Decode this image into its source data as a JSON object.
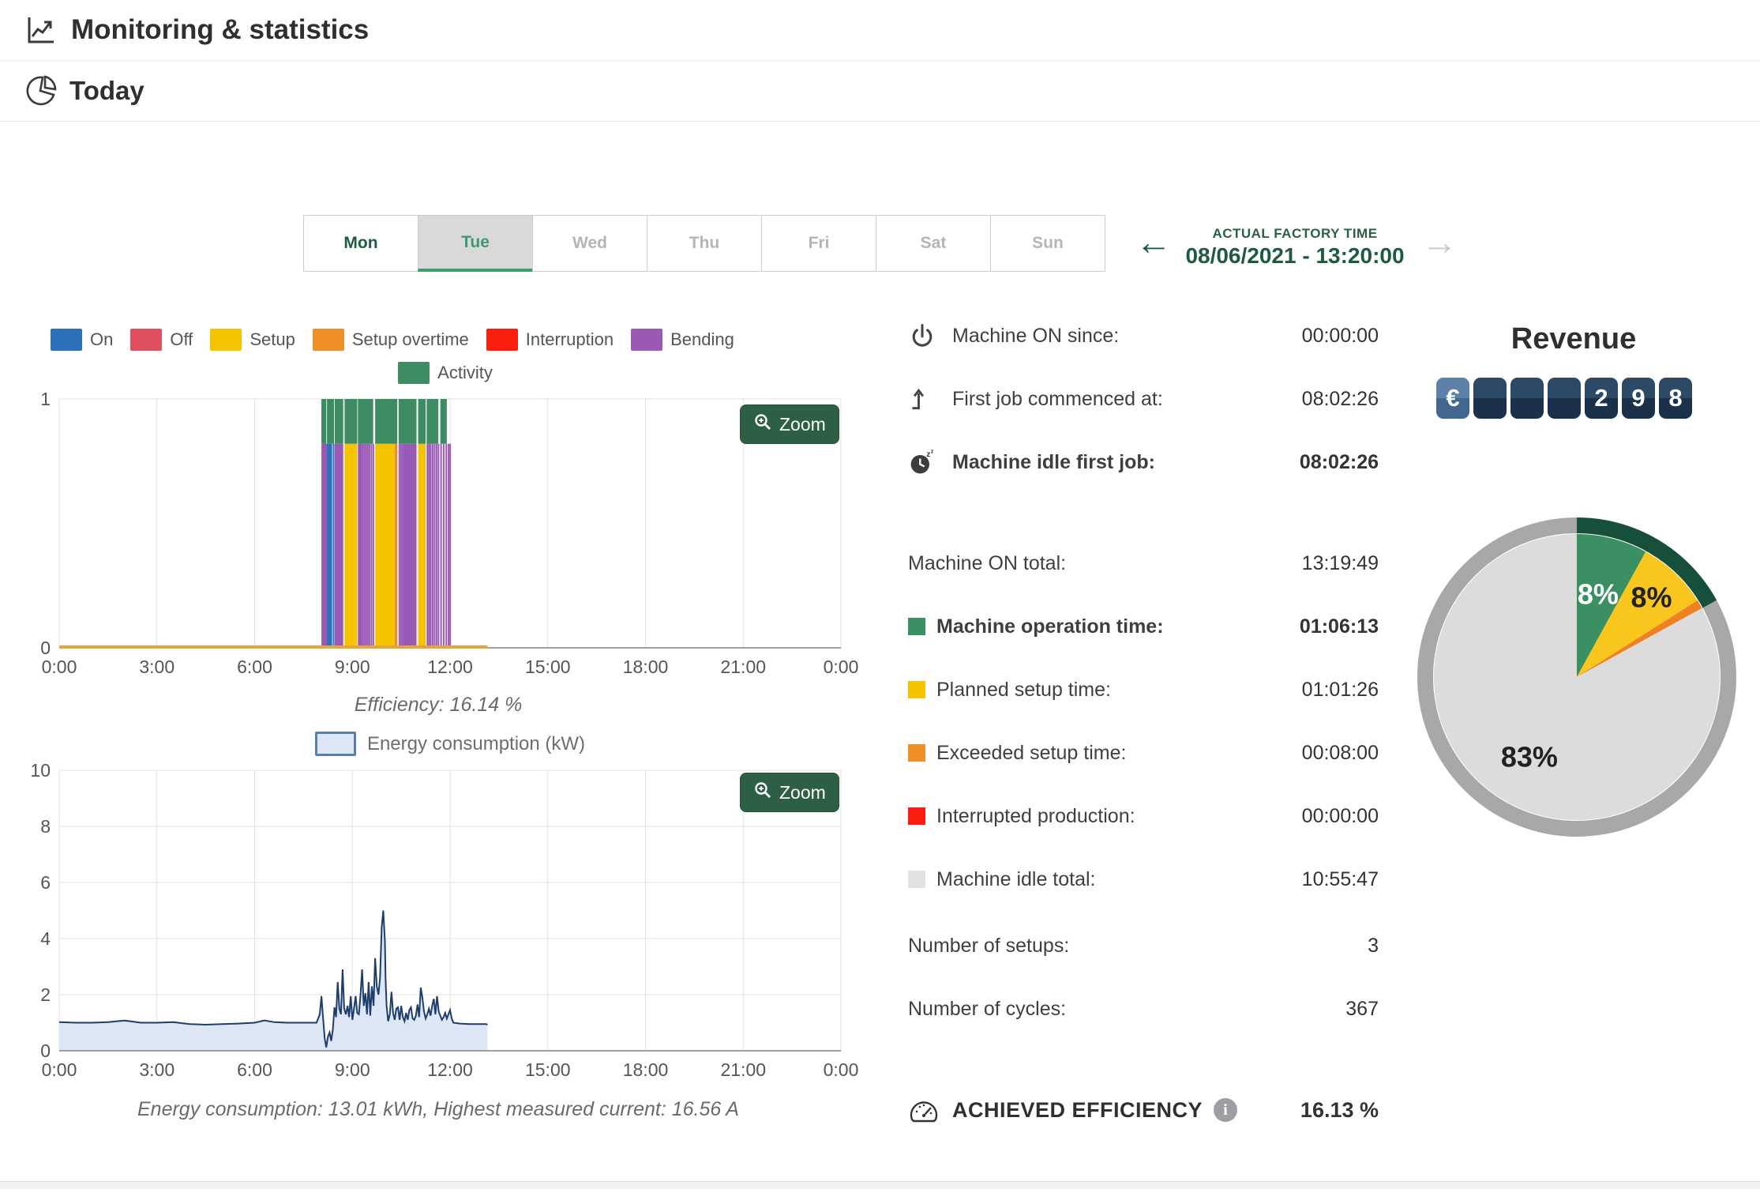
{
  "header": {
    "title": "Monitoring & statistics"
  },
  "section": {
    "title": "Today"
  },
  "tabs": [
    {
      "label": "Mon",
      "state": "enabled"
    },
    {
      "label": "Tue",
      "state": "active"
    },
    {
      "label": "Wed",
      "state": "disabled"
    },
    {
      "label": "Thu",
      "state": "disabled"
    },
    {
      "label": "Fri",
      "state": "disabled"
    },
    {
      "label": "Sat",
      "state": "disabled"
    },
    {
      "label": "Sun",
      "state": "disabled"
    }
  ],
  "factory_time": {
    "label": "ACTUAL FACTORY TIME",
    "value": "08/06/2021 - 13:20:00",
    "prev_arrow": "←",
    "next_arrow": "→"
  },
  "zoom_button_label": "Zoom",
  "legend_states": [
    {
      "label": "On",
      "color": "#2d72b8"
    },
    {
      "label": "Off",
      "color": "#e04f5f"
    },
    {
      "label": "Setup",
      "color": "#f5c300"
    },
    {
      "label": "Setup overtime",
      "color": "#ee8e25"
    },
    {
      "label": "Interruption",
      "color": "#fa1e0e"
    },
    {
      "label": "Bending",
      "color": "#9b59b6"
    }
  ],
  "legend_activity": {
    "label": "Activity",
    "color": "#3e8d62"
  },
  "energy_legend": {
    "label": "Energy consumption (kW)",
    "fill": "#dce6f5",
    "border": "#5b7fa6"
  },
  "captions": {
    "efficiency": "Efficiency: 16.14 %",
    "energy": "Energy consumption: 13.01 kWh, Highest measured current: 16.56 A"
  },
  "chart_data": [
    {
      "type": "timeline",
      "x_ticks": [
        "0:00",
        "3:00",
        "6:00",
        "9:00",
        "12:00",
        "15:00",
        "18:00",
        "21:00",
        "0:00"
      ],
      "x_range_hours": [
        0,
        24
      ],
      "y_ticks": [
        "0",
        "1"
      ],
      "band_split": 0.82,
      "baseline": {
        "start": 0,
        "end": 13.15,
        "color": "#e8a33d"
      },
      "colors": {
        "on": "#2d72b8",
        "off": "#e04f5f",
        "setup": "#f5c300",
        "setup_overtime": "#ee8e25",
        "interruption": "#fa1e0e",
        "bending": "#9b59b6",
        "activity": "#3e8d62"
      },
      "state_segments": [
        {
          "s": 8.05,
          "e": 8.08,
          "c": "bending"
        },
        {
          "s": 8.09,
          "e": 8.11,
          "c": "bending"
        },
        {
          "s": 8.12,
          "e": 8.14,
          "c": "bending"
        },
        {
          "s": 8.15,
          "e": 8.17,
          "c": "bending"
        },
        {
          "s": 8.18,
          "e": 8.21,
          "c": "bending"
        },
        {
          "s": 8.22,
          "e": 8.38,
          "c": "on"
        },
        {
          "s": 8.4,
          "e": 8.43,
          "c": "on"
        },
        {
          "s": 8.46,
          "e": 8.49,
          "c": "bending"
        },
        {
          "s": 8.5,
          "e": 8.52,
          "c": "bending"
        },
        {
          "s": 8.54,
          "e": 8.57,
          "c": "bending"
        },
        {
          "s": 8.58,
          "e": 8.6,
          "c": "bending"
        },
        {
          "s": 8.62,
          "e": 8.65,
          "c": "bending"
        },
        {
          "s": 8.66,
          "e": 8.72,
          "c": "bending"
        },
        {
          "s": 8.76,
          "e": 9.15,
          "c": "setup"
        },
        {
          "s": 9.17,
          "e": 9.19,
          "c": "bending"
        },
        {
          "s": 9.21,
          "e": 9.23,
          "c": "bending"
        },
        {
          "s": 9.25,
          "e": 9.28,
          "c": "bending"
        },
        {
          "s": 9.3,
          "e": 9.32,
          "c": "bending"
        },
        {
          "s": 9.35,
          "e": 9.37,
          "c": "bending"
        },
        {
          "s": 9.4,
          "e": 9.42,
          "c": "bending"
        },
        {
          "s": 9.45,
          "e": 9.47,
          "c": "bending"
        },
        {
          "s": 9.5,
          "e": 9.53,
          "c": "bending"
        },
        {
          "s": 9.56,
          "e": 9.58,
          "c": "bending"
        },
        {
          "s": 9.62,
          "e": 9.64,
          "c": "bending"
        },
        {
          "s": 9.7,
          "e": 10.3,
          "c": "setup"
        },
        {
          "s": 10.3,
          "e": 10.38,
          "c": "setup_overtime"
        },
        {
          "s": 10.42,
          "e": 10.44,
          "c": "bending"
        },
        {
          "s": 10.47,
          "e": 10.49,
          "c": "bending"
        },
        {
          "s": 10.52,
          "e": 10.54,
          "c": "bending"
        },
        {
          "s": 10.57,
          "e": 10.97,
          "c": "bending"
        },
        {
          "s": 11.02,
          "e": 11.25,
          "c": "setup"
        },
        {
          "s": 11.28,
          "e": 11.3,
          "c": "bending"
        },
        {
          "s": 11.33,
          "e": 11.35,
          "c": "bending"
        },
        {
          "s": 11.38,
          "e": 11.4,
          "c": "bending"
        },
        {
          "s": 11.44,
          "e": 11.46,
          "c": "bending"
        },
        {
          "s": 11.5,
          "e": 11.52,
          "c": "bending"
        },
        {
          "s": 11.56,
          "e": 11.58,
          "c": "bending"
        },
        {
          "s": 11.62,
          "e": 11.64,
          "c": "bending"
        },
        {
          "s": 11.7,
          "e": 11.72,
          "c": "bending"
        },
        {
          "s": 11.78,
          "e": 11.8,
          "c": "bending"
        },
        {
          "s": 11.86,
          "e": 11.88,
          "c": "bending"
        },
        {
          "s": 11.93,
          "e": 11.94,
          "c": "bending"
        },
        {
          "s": 11.98,
          "e": 11.99,
          "c": "bending"
        }
      ],
      "activity_segments": [
        {
          "s": 8.05,
          "e": 8.2
        },
        {
          "s": 8.22,
          "e": 8.44
        },
        {
          "s": 8.46,
          "e": 8.72
        },
        {
          "s": 8.76,
          "e": 9.15
        },
        {
          "s": 9.17,
          "e": 9.64
        },
        {
          "s": 9.7,
          "e": 10.38
        },
        {
          "s": 10.42,
          "e": 10.97
        },
        {
          "s": 11.02,
          "e": 11.25
        },
        {
          "s": 11.28,
          "e": 11.64
        },
        {
          "s": 11.7,
          "e": 11.9
        }
      ]
    },
    {
      "type": "area",
      "series_label": "Energy consumption (kW)",
      "x_ticks": [
        "0:00",
        "3:00",
        "6:00",
        "9:00",
        "12:00",
        "15:00",
        "18:00",
        "21:00",
        "0:00"
      ],
      "x_range_hours": [
        0,
        24
      ],
      "y_ticks": [
        0,
        2,
        4,
        6,
        8,
        10
      ],
      "ylim": [
        0,
        10
      ],
      "line_color": "#1e3d6b",
      "fill_color": "#dce6f5",
      "points": [
        [
          0,
          1.02
        ],
        [
          0.5,
          1.0
        ],
        [
          1,
          1.0
        ],
        [
          1.5,
          1.02
        ],
        [
          2,
          1.08
        ],
        [
          2.2,
          1.05
        ],
        [
          2.5,
          1.0
        ],
        [
          3,
          1.0
        ],
        [
          3.5,
          1.02
        ],
        [
          4,
          0.95
        ],
        [
          4.5,
          0.93
        ],
        [
          5,
          0.95
        ],
        [
          5.5,
          0.97
        ],
        [
          6,
          1.0
        ],
        [
          6.3,
          1.08
        ],
        [
          6.6,
          1.02
        ],
        [
          7,
          1.0
        ],
        [
          7.5,
          1.0
        ],
        [
          7.9,
          1.0
        ],
        [
          8.0,
          1.3
        ],
        [
          8.05,
          1.95
        ],
        [
          8.1,
          1.2
        ],
        [
          8.15,
          0.45
        ],
        [
          8.2,
          0.12
        ],
        [
          8.25,
          0.5
        ],
        [
          8.3,
          0.65
        ],
        [
          8.35,
          0.35
        ],
        [
          8.4,
          0.75
        ],
        [
          8.45,
          1.55
        ],
        [
          8.5,
          1.2
        ],
        [
          8.55,
          2.45
        ],
        [
          8.6,
          1.5
        ],
        [
          8.65,
          1.3
        ],
        [
          8.7,
          2.9
        ],
        [
          8.75,
          1.5
        ],
        [
          8.8,
          1.3
        ],
        [
          8.85,
          1.6
        ],
        [
          8.9,
          1.2
        ],
        [
          8.95,
          1.95
        ],
        [
          9.0,
          1.1
        ],
        [
          9.05,
          1.5
        ],
        [
          9.1,
          1.95
        ],
        [
          9.15,
          1.35
        ],
        [
          9.2,
          1.3
        ],
        [
          9.25,
          2.0
        ],
        [
          9.3,
          2.9
        ],
        [
          9.35,
          1.6
        ],
        [
          9.4,
          2.05
        ],
        [
          9.45,
          1.3
        ],
        [
          9.5,
          2.45
        ],
        [
          9.55,
          1.25
        ],
        [
          9.6,
          2.3
        ],
        [
          9.65,
          1.6
        ],
        [
          9.7,
          3.3
        ],
        [
          9.75,
          2.3
        ],
        [
          9.8,
          2.0
        ],
        [
          9.85,
          2.6
        ],
        [
          9.9,
          4.4
        ],
        [
          9.95,
          5.0
        ],
        [
          10.0,
          3.9
        ],
        [
          10.02,
          2.6
        ],
        [
          10.05,
          1.6
        ],
        [
          10.1,
          1.05
        ],
        [
          10.15,
          1.3
        ],
        [
          10.2,
          2.1
        ],
        [
          10.25,
          1.35
        ],
        [
          10.3,
          1.1
        ],
        [
          10.35,
          1.5
        ],
        [
          10.4,
          1.55
        ],
        [
          10.45,
          1.1
        ],
        [
          10.5,
          1.6
        ],
        [
          10.55,
          1.2
        ],
        [
          10.6,
          1.05
        ],
        [
          10.65,
          1.35
        ],
        [
          10.7,
          1.1
        ],
        [
          10.75,
          1.45
        ],
        [
          10.8,
          1.55
        ],
        [
          10.85,
          1.15
        ],
        [
          10.9,
          1.1
        ],
        [
          10.95,
          1.25
        ],
        [
          11.0,
          1.65
        ],
        [
          11.05,
          1.2
        ],
        [
          11.1,
          2.25
        ],
        [
          11.15,
          1.9
        ],
        [
          11.2,
          1.4
        ],
        [
          11.25,
          1.15
        ],
        [
          11.3,
          1.3
        ],
        [
          11.35,
          1.5
        ],
        [
          11.4,
          1.25
        ],
        [
          11.45,
          1.6
        ],
        [
          11.5,
          1.85
        ],
        [
          11.55,
          1.3
        ],
        [
          11.6,
          1.95
        ],
        [
          11.65,
          1.4
        ],
        [
          11.7,
          1.25
        ],
        [
          11.75,
          1.1
        ],
        [
          11.8,
          1.2
        ],
        [
          11.85,
          1.35
        ],
        [
          11.9,
          1.15
        ],
        [
          12.0,
          1.45
        ],
        [
          12.05,
          1.15
        ],
        [
          12.1,
          1.0
        ],
        [
          12.3,
          0.97
        ],
        [
          12.6,
          0.95
        ],
        [
          12.9,
          0.95
        ],
        [
          13.1,
          0.95
        ],
        [
          13.15,
          0.93
        ]
      ]
    },
    {
      "type": "pie",
      "slices": [
        {
          "label": "Machine operation time",
          "value": 8,
          "display": "8%",
          "color": "#3a8f63",
          "label_color": "#ffffff"
        },
        {
          "label": "Planned setup time",
          "value": 8,
          "display": "8%",
          "color": "#f8c61d",
          "label_color": "#222222"
        },
        {
          "label": "Exceeded setup time",
          "value": 1,
          "display": "",
          "color": "#f08122",
          "label_color": "#222222"
        },
        {
          "label": "Machine idle total",
          "value": 83,
          "display": "83%",
          "color": "#dcdcdc",
          "label_color": "#222222"
        }
      ],
      "ring_color": "#a8a8a8",
      "ring_active_color": "#17503a",
      "legend_position": "none",
      "grid": false
    }
  ],
  "stats": {
    "group_machine": [
      {
        "icon": "power-icon",
        "label": "Machine ON since:",
        "value": "00:00:00",
        "bold": false
      },
      {
        "icon": "first-job-icon",
        "label": "First job commenced at:",
        "value": "08:02:26",
        "bold": false
      },
      {
        "icon": "idle-clock-icon",
        "label": "Machine idle first job:",
        "value": "08:02:26",
        "bold": true
      }
    ],
    "group_times": [
      {
        "swatch": "",
        "label": "Machine ON total:",
        "value": "13:19:49",
        "bold": false
      },
      {
        "swatch": "#3a8f63",
        "label": "Machine operation time:",
        "value": "01:06:13",
        "bold": true
      },
      {
        "swatch": "#f5c300",
        "label": "Planned setup time:",
        "value": "01:01:26",
        "bold": false
      },
      {
        "swatch": "#ee8e25",
        "label": "Exceeded setup time:",
        "value": "00:08:00",
        "bold": false
      },
      {
        "swatch": "#fa1e0e",
        "label": "Interrupted production:",
        "value": "00:00:00",
        "bold": false
      },
      {
        "swatch": "#e2e2e2",
        "label": "Machine idle total:",
        "value": "10:55:47",
        "bold": false
      }
    ],
    "group_counts": [
      {
        "label": "Number of setups:",
        "value": "3",
        "bold": false
      },
      {
        "label": "Number of cycles:",
        "value": "367",
        "bold": false
      }
    ],
    "efficiency": {
      "label": "ACHIEVED EFFICIENCY",
      "info": "i",
      "value": "16.13 %"
    }
  },
  "revenue": {
    "title": "Revenue",
    "currency": "€",
    "digits": [
      "",
      "",
      "",
      "2",
      "9",
      "8"
    ]
  }
}
